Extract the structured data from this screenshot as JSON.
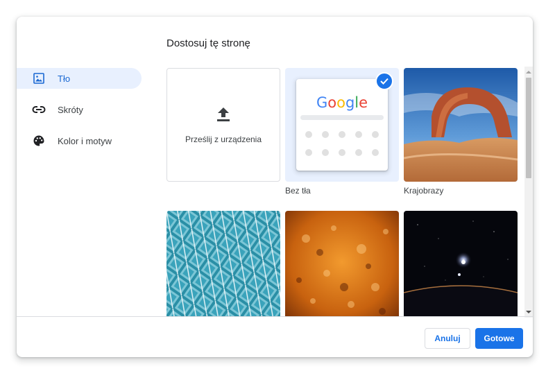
{
  "dialog": {
    "title": "Dostosuj tę stronę"
  },
  "sidebar": {
    "items": [
      {
        "label": "Tło",
        "icon": "wallpaper-icon",
        "selected": true
      },
      {
        "label": "Skróty",
        "icon": "link-icon",
        "selected": false
      },
      {
        "label": "Kolor i motyw",
        "icon": "palette-icon",
        "selected": false
      }
    ]
  },
  "backgrounds": {
    "upload_label": "Prześlij z urządzenia",
    "no_background_label": "Bez tła",
    "google_logo": "Google",
    "landscapes_label": "Krajobrazy"
  },
  "footer": {
    "cancel_label": "Anuluj",
    "done_label": "Gotowe"
  },
  "colors": {
    "accent": "#1a73e8",
    "selected_bg": "#e8f0fe"
  }
}
